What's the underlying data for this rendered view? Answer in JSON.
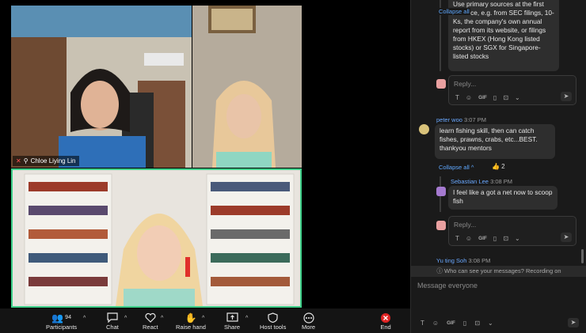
{
  "videos": {
    "tile_a": {
      "name": "Chloe Liying Lin"
    }
  },
  "toolbar": {
    "participants": {
      "label": "Participants",
      "count": "94"
    },
    "chat": {
      "label": "Chat"
    },
    "react": {
      "label": "React"
    },
    "raise_hand": {
      "label": "Raise hand"
    },
    "share": {
      "label": "Share"
    },
    "host_tools": {
      "label": "Host tools"
    },
    "more": {
      "label": "More"
    },
    "end": {
      "label": "End"
    }
  },
  "chat": {
    "thread1": {
      "collapse": "Collapse all",
      "message": "Use primary sources at the first instance, e.g. from SEC filings, 10-Ks, the company's own annual report from its website, or filings from HKEX (Hong Kong listed stocks) or SGX for Singapore-listed stocks",
      "reply_placeholder": "Reply..."
    },
    "message2": {
      "sender": "peter woo",
      "time": "3:07 PM",
      "text": "learn fishing skill, then can catch fishes, prawns, crabs, etc...BEST. thankyou mentors",
      "collapse": "Collapse all",
      "reaction": "👍 2"
    },
    "reply2": {
      "sender": "Sebastian Lee",
      "time": "3:08 PM",
      "text": "I feel like a got a net now to scoop fish",
      "reply_placeholder": "Reply..."
    },
    "message3": {
      "sender": "Yu ting Soh",
      "time": "3:08 PM"
    },
    "privacy_notice": "Who can see your messages? Recording on",
    "input_placeholder": "Message everyone",
    "toolbar": {
      "gif": "GIF"
    }
  },
  "colors": {
    "accent": "#5fa8ff",
    "speaker_border": "#3fd08a",
    "end": "#e02424"
  }
}
